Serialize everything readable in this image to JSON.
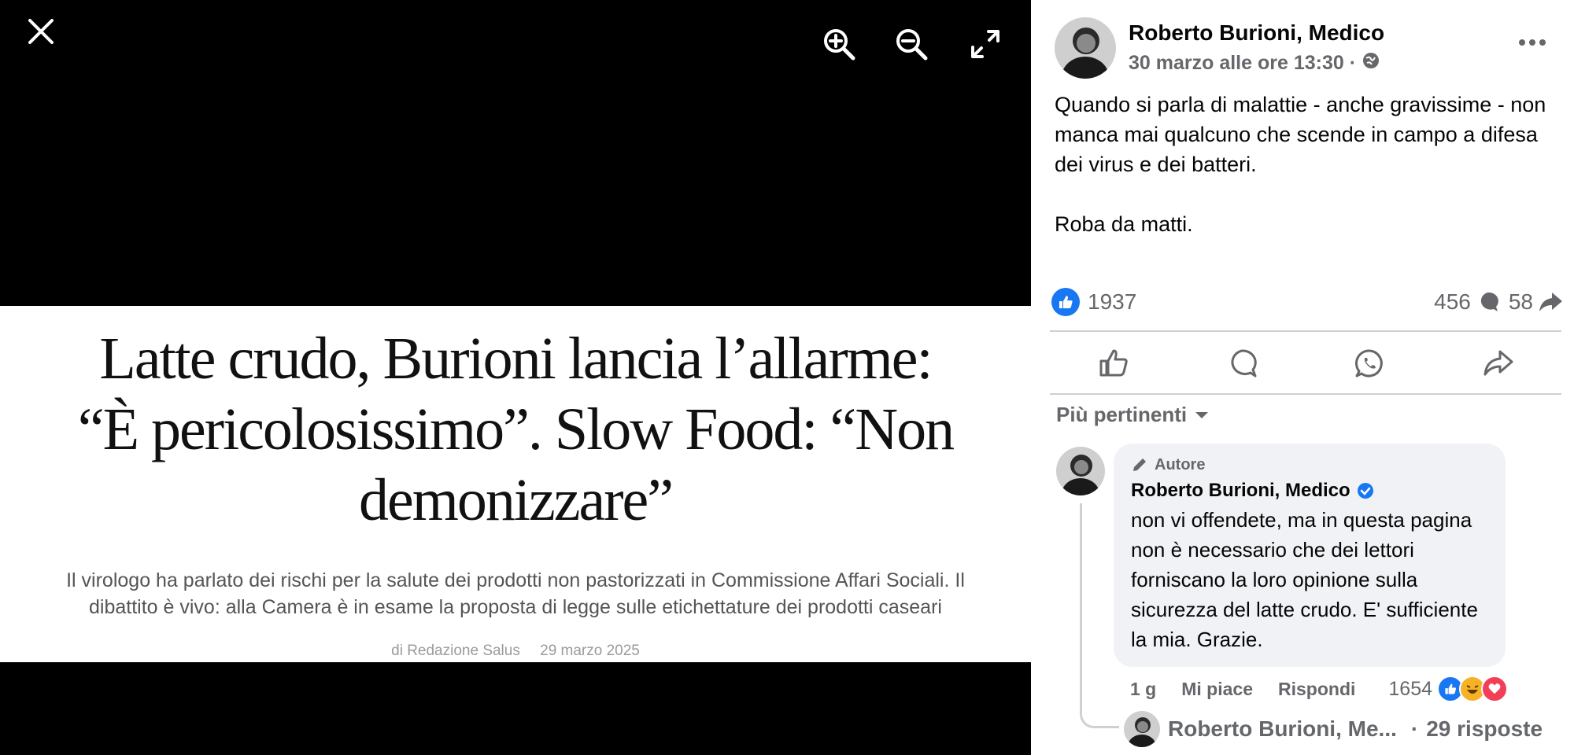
{
  "viewer": {
    "article": {
      "headline": "Latte crudo, Burioni lancia l’allarme: “È pericolosissimo”. Slow Food: “Non demonizzare”",
      "subtitle": "Il virologo ha parlato dei rischi per la salute dei prodotti non pastorizzati in Commissione Affari Sociali. Il dibattito è vivo: alla Camera è in esame la proposta di legge sulle etichettature dei prodotti caseari",
      "byline": "di Redazione Salus",
      "date": "29 marzo 2025"
    },
    "tools": [
      "close-icon",
      "zoom-in-icon",
      "zoom-out-icon",
      "fullscreen-icon"
    ]
  },
  "post": {
    "author": "Roberto Burioni, Medico",
    "timestamp": "30 marzo alle ore 13:30 ·",
    "paragraph1": "Quando si parla di malattie - anche gravissime - non manca mai qualcuno che scende in campo a difesa dei virus e dei batteri.",
    "paragraph2": "Roba da matti.",
    "reactions_count": "1937",
    "comments_count": "456",
    "shares_count": "58"
  },
  "comments": {
    "filter_label": "Più pertinenti",
    "top": {
      "badge": "Autore",
      "author": "Roberto Burioni, Medico",
      "text": "non vi offendete, ma in questa pagina non è necessario che dei lettori forniscano la loro opinione sulla sicurezza del latte crudo. E' sufficiente la mia. Grazie.",
      "age": "1 g",
      "like_label": "Mi piace",
      "reply_label": "Rispondi",
      "reactions_count": "1654"
    },
    "replies": {
      "name": "Roberto Burioni, Me...",
      "count_label": "29 risposte"
    }
  },
  "colors": {
    "facebook_blue": "#1877f2",
    "secondary_text": "#65676b",
    "bubble_bg": "#f0f2f5"
  }
}
